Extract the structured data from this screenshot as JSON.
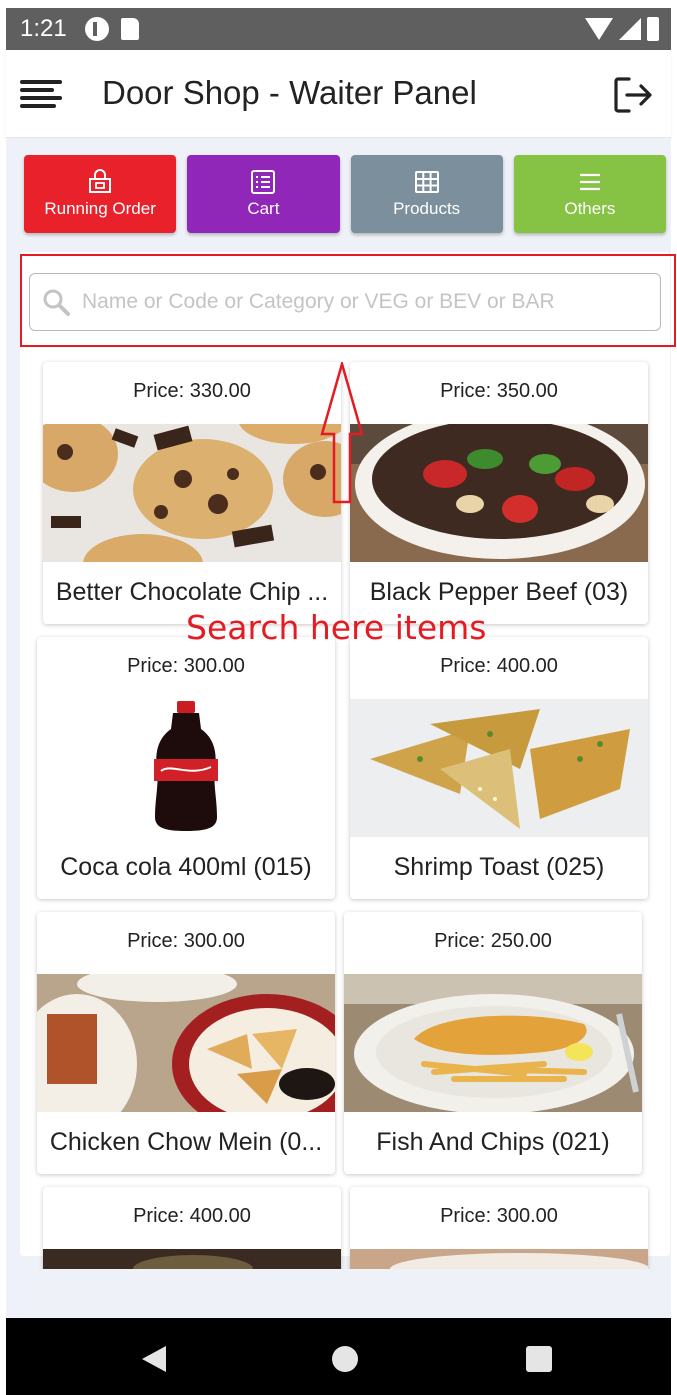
{
  "status_bar": {
    "time": "1:21",
    "icons": [
      "app-notification-icon",
      "sd-card-icon",
      "wifi-icon",
      "signal-icon",
      "battery-icon"
    ]
  },
  "app_bar": {
    "title": "Door Shop - Waiter Panel",
    "icons": [
      "hamburger-menu-icon",
      "logout-icon"
    ]
  },
  "nav_buttons": [
    {
      "label": "Running Order",
      "color": "#e8212b",
      "icon": "shopping-bag-icon"
    },
    {
      "label": "Cart",
      "color": "#9127b8",
      "icon": "list-icon"
    },
    {
      "label": "Products",
      "color": "#7b909c",
      "icon": "grid-icon"
    },
    {
      "label": "Others",
      "color": "#86c243",
      "icon": "menu-lines-icon"
    }
  ],
  "search": {
    "placeholder": "Name or Code or Category or VEG or BEV or BAR",
    "value": ""
  },
  "annotation": {
    "text": "Search here items",
    "color": "#e31b23"
  },
  "products": [
    {
      "price_label": "Price: 330.00",
      "name": "Better Chocolate Chip ...",
      "image": "chocolate-chip-cookies"
    },
    {
      "price_label": "Price: 350.00",
      "name": "Black Pepper Beef (03)",
      "image": "black-pepper-beef"
    },
    {
      "price_label": "Price: 300.00",
      "name": "Coca cola 400ml (015)",
      "image": "coca-cola-bottle"
    },
    {
      "price_label": "Price: 400.00",
      "name": "Shrimp Toast (025)",
      "image": "shrimp-toast"
    },
    {
      "price_label": "Price: 300.00",
      "name": "Chicken Chow Mein (0...",
      "image": "chicken-chow-mein"
    },
    {
      "price_label": "Price: 250.00",
      "name": "Fish And Chips (021)",
      "image": "fish-and-chips"
    },
    {
      "price_label": "Price: 400.00",
      "name": "",
      "image": "dish"
    },
    {
      "price_label": "Price: 300.00",
      "name": "",
      "image": "dish"
    }
  ],
  "colors": {
    "accent_red": "#e31b23",
    "content_background": "#eef1f7"
  }
}
